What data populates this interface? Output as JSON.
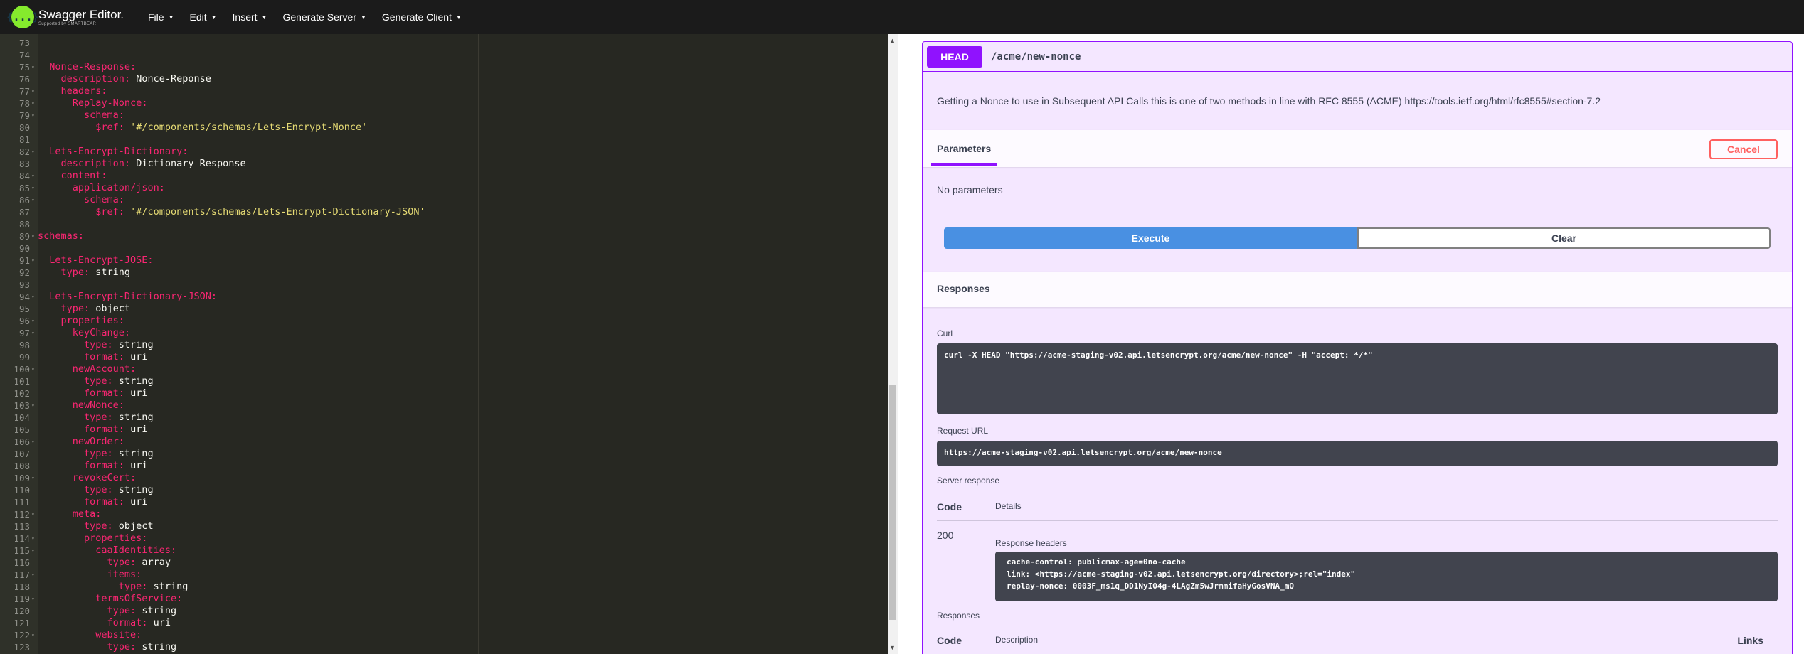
{
  "app": {
    "logo_glyph": "{...}",
    "logo_title": "Swagger Editor.",
    "logo_subtitle": "Supported by SMARTBEAR"
  },
  "menu": [
    {
      "label": "File"
    },
    {
      "label": "Edit"
    },
    {
      "label": "Insert"
    },
    {
      "label": "Generate Server"
    },
    {
      "label": "Generate Client"
    }
  ],
  "editor": {
    "lines": [
      {
        "n": "73",
        "fold": false,
        "indent": "",
        "key": "",
        "val": "",
        "str": ""
      },
      {
        "n": "74",
        "fold": false,
        "indent": "",
        "key": "",
        "val": "",
        "str": ""
      },
      {
        "n": "75",
        "fold": true,
        "indent": "  ",
        "key": "Nonce-Response:",
        "val": "",
        "str": ""
      },
      {
        "n": "76",
        "fold": false,
        "indent": "    ",
        "key": "description:",
        "val": " Nonce-Reponse",
        "str": ""
      },
      {
        "n": "77",
        "fold": true,
        "indent": "    ",
        "key": "headers:",
        "val": "",
        "str": ""
      },
      {
        "n": "78",
        "fold": true,
        "indent": "      ",
        "key": "Replay-Nonce:",
        "val": "",
        "str": ""
      },
      {
        "n": "79",
        "fold": true,
        "indent": "        ",
        "key": "schema:",
        "val": "",
        "str": ""
      },
      {
        "n": "80",
        "fold": false,
        "indent": "          ",
        "key": "$ref:",
        "val": " ",
        "str": "'#/components/schemas/Lets-Encrypt-Nonce'"
      },
      {
        "n": "81",
        "fold": false,
        "indent": "",
        "key": "",
        "val": "",
        "str": ""
      },
      {
        "n": "82",
        "fold": true,
        "indent": "  ",
        "key": "Lets-Encrypt-Dictionary:",
        "val": "",
        "str": ""
      },
      {
        "n": "83",
        "fold": false,
        "indent": "    ",
        "key": "description:",
        "val": " Dictionary Response",
        "str": ""
      },
      {
        "n": "84",
        "fold": true,
        "indent": "    ",
        "key": "content:",
        "val": "",
        "str": ""
      },
      {
        "n": "85",
        "fold": true,
        "indent": "      ",
        "key": "applicaton/json:",
        "val": "",
        "str": ""
      },
      {
        "n": "86",
        "fold": true,
        "indent": "        ",
        "key": "schema:",
        "val": "",
        "str": ""
      },
      {
        "n": "87",
        "fold": false,
        "indent": "          ",
        "key": "$ref:",
        "val": " ",
        "str": "'#/components/schemas/Lets-Encrypt-Dictionary-JSON'"
      },
      {
        "n": "88",
        "fold": false,
        "indent": "",
        "key": "",
        "val": "",
        "str": ""
      },
      {
        "n": "89",
        "fold": true,
        "indent": "",
        "key": "schemas:",
        "val": "",
        "str": ""
      },
      {
        "n": "90",
        "fold": false,
        "indent": "",
        "key": "",
        "val": "",
        "str": ""
      },
      {
        "n": "91",
        "fold": true,
        "indent": "  ",
        "key": "Lets-Encrypt-JOSE:",
        "val": "",
        "str": ""
      },
      {
        "n": "92",
        "fold": false,
        "indent": "    ",
        "key": "type:",
        "val": " string",
        "str": ""
      },
      {
        "n": "93",
        "fold": false,
        "indent": "",
        "key": "",
        "val": "",
        "str": ""
      },
      {
        "n": "94",
        "fold": true,
        "indent": "  ",
        "key": "Lets-Encrypt-Dictionary-JSON:",
        "val": "",
        "str": ""
      },
      {
        "n": "95",
        "fold": false,
        "indent": "    ",
        "key": "type:",
        "val": " object",
        "str": ""
      },
      {
        "n": "96",
        "fold": true,
        "indent": "    ",
        "key": "properties:",
        "val": "",
        "str": ""
      },
      {
        "n": "97",
        "fold": true,
        "indent": "      ",
        "key": "keyChange:",
        "val": "",
        "str": ""
      },
      {
        "n": "98",
        "fold": false,
        "indent": "        ",
        "key": "type:",
        "val": " string",
        "str": ""
      },
      {
        "n": "99",
        "fold": false,
        "indent": "        ",
        "key": "format:",
        "val": " uri",
        "str": ""
      },
      {
        "n": "100",
        "fold": true,
        "indent": "      ",
        "key": "newAccount:",
        "val": "",
        "str": ""
      },
      {
        "n": "101",
        "fold": false,
        "indent": "        ",
        "key": "type:",
        "val": " string",
        "str": ""
      },
      {
        "n": "102",
        "fold": false,
        "indent": "        ",
        "key": "format:",
        "val": " uri",
        "str": ""
      },
      {
        "n": "103",
        "fold": true,
        "indent": "      ",
        "key": "newNonce:",
        "val": "",
        "str": ""
      },
      {
        "n": "104",
        "fold": false,
        "indent": "        ",
        "key": "type:",
        "val": " string",
        "str": ""
      },
      {
        "n": "105",
        "fold": false,
        "indent": "        ",
        "key": "format:",
        "val": " uri",
        "str": ""
      },
      {
        "n": "106",
        "fold": true,
        "indent": "      ",
        "key": "newOrder:",
        "val": "",
        "str": ""
      },
      {
        "n": "107",
        "fold": false,
        "indent": "        ",
        "key": "type:",
        "val": " string",
        "str": ""
      },
      {
        "n": "108",
        "fold": false,
        "indent": "        ",
        "key": "format:",
        "val": " uri",
        "str": ""
      },
      {
        "n": "109",
        "fold": true,
        "indent": "      ",
        "key": "revokeCert:",
        "val": "",
        "str": ""
      },
      {
        "n": "110",
        "fold": false,
        "indent": "        ",
        "key": "type:",
        "val": " string",
        "str": ""
      },
      {
        "n": "111",
        "fold": false,
        "indent": "        ",
        "key": "format:",
        "val": " uri",
        "str": ""
      },
      {
        "n": "112",
        "fold": true,
        "indent": "      ",
        "key": "meta:",
        "val": "",
        "str": ""
      },
      {
        "n": "113",
        "fold": false,
        "indent": "        ",
        "key": "type:",
        "val": " object",
        "str": ""
      },
      {
        "n": "114",
        "fold": true,
        "indent": "        ",
        "key": "properties:",
        "val": "",
        "str": ""
      },
      {
        "n": "115",
        "fold": true,
        "indent": "          ",
        "key": "caaIdentities:",
        "val": "",
        "str": ""
      },
      {
        "n": "116",
        "fold": false,
        "indent": "            ",
        "key": "type:",
        "val": " array",
        "str": ""
      },
      {
        "n": "117",
        "fold": true,
        "indent": "            ",
        "key": "items:",
        "val": "",
        "str": ""
      },
      {
        "n": "118",
        "fold": false,
        "indent": "              ",
        "key": "type:",
        "val": " string",
        "str": ""
      },
      {
        "n": "119",
        "fold": true,
        "indent": "          ",
        "key": "termsOfService:",
        "val": "",
        "str": ""
      },
      {
        "n": "120",
        "fold": false,
        "indent": "            ",
        "key": "type:",
        "val": " string",
        "str": ""
      },
      {
        "n": "121",
        "fold": false,
        "indent": "            ",
        "key": "format:",
        "val": " uri",
        "str": ""
      },
      {
        "n": "122",
        "fold": true,
        "indent": "          ",
        "key": "website:",
        "val": "",
        "str": ""
      },
      {
        "n": "123",
        "fold": false,
        "indent": "            ",
        "key": "type:",
        "val": " string",
        "str": ""
      }
    ]
  },
  "operation": {
    "method": "HEAD",
    "path": "/acme/new-nonce",
    "description": "Getting a Nonce to use in Subsequent API Calls this is one of two methods in line with RFC 8555 (ACME) https://tools.ietf.org/html/rfc8555#section-7.2",
    "parameters_tab": "Parameters",
    "cancel_label": "Cancel",
    "no_parameters": "No parameters",
    "execute_label": "Execute",
    "clear_label": "Clear",
    "responses_title": "Responses",
    "curl_label": "Curl",
    "curl_command": "curl -X HEAD \"https://acme-staging-v02.api.letsencrypt.org/acme/new-nonce\" -H \"accept: */*\"",
    "request_url_label": "Request URL",
    "request_url": "https://acme-staging-v02.api.letsencrypt.org/acme/new-nonce",
    "server_response_label": "Server response",
    "code_header": "Code",
    "details_header": "Details",
    "status_code": "200",
    "response_headers_label": "Response headers",
    "response_headers": "cache-control: publicmax-age=0no-cache\nlink: <https://acme-staging-v02.api.letsencrypt.org/directory>;rel=\"index\"\nreplay-nonce: 0003F_ms1q_DD1NyIO4g-4LAgZm5wJrmmifaHyGosVNA_mQ",
    "responses_title_2": "Responses",
    "code_header_2": "Code",
    "description_header": "Description",
    "links_header": "Links"
  },
  "colors": {
    "head_method": "#9012fe",
    "execute": "#4990e2",
    "cancel": "#ff6060",
    "editor_bg": "#272822",
    "yaml_key": "#f92672",
    "yaml_string": "#e6db74"
  }
}
